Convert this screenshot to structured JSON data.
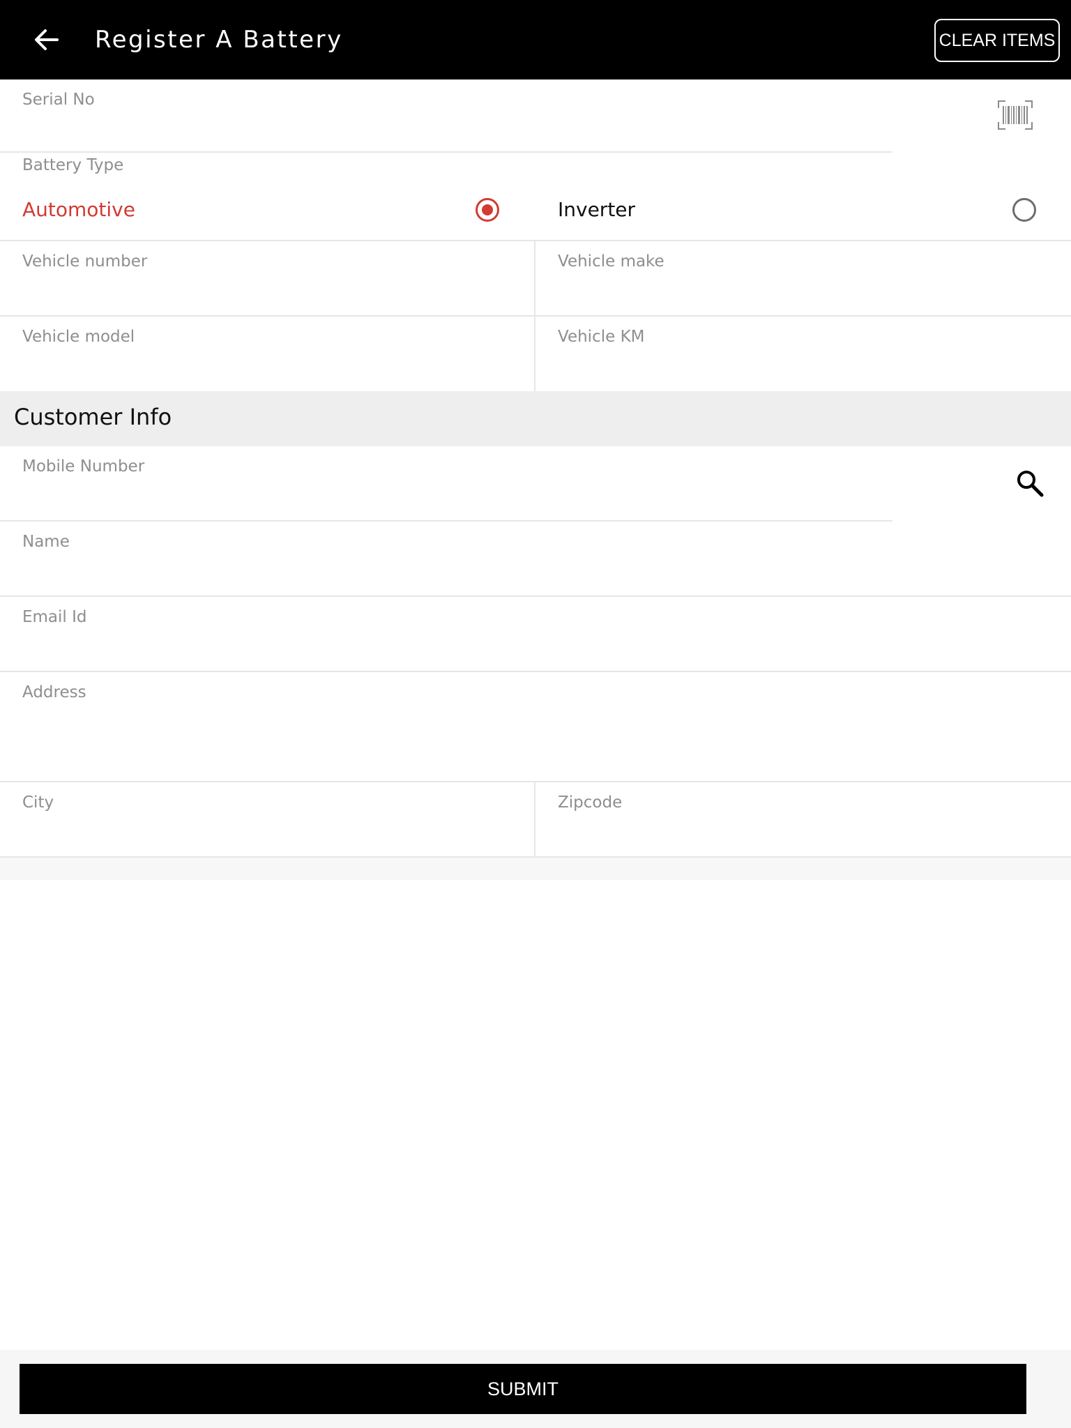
{
  "header": {
    "title": "Register A Battery",
    "clear_label": "CLEAR ITEMS",
    "back_icon": "arrow-left-icon"
  },
  "serial": {
    "label": "Serial No",
    "value": "",
    "scan_icon": "barcode-scan-icon"
  },
  "battery_type": {
    "label": "Battery Type",
    "options": [
      {
        "label": "Automotive",
        "selected": true
      },
      {
        "label": "Inverter",
        "selected": false
      }
    ]
  },
  "vehicle": {
    "number_label": "Vehicle number",
    "make_label": "Vehicle make",
    "model_label": "Vehicle model",
    "km_label": "Vehicle KM"
  },
  "customer": {
    "section_title": "Customer Info",
    "mobile_label": "Mobile Number",
    "search_icon": "search-icon",
    "name_label": "Name",
    "email_label": "Email Id",
    "address_label": "Address",
    "city_label": "City",
    "zip_label": "Zipcode"
  },
  "footer": {
    "submit_label": "SUBMIT"
  },
  "colors": {
    "accent": "#d23a33",
    "header_bg": "#000000",
    "label": "#8e8e8e",
    "section_bg": "#eeeeee"
  }
}
